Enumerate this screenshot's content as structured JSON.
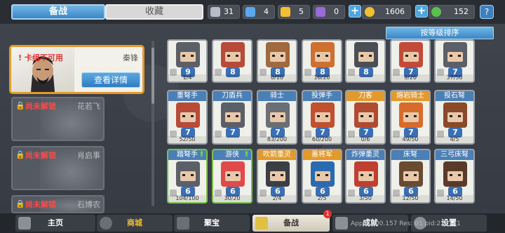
{
  "tabs": {
    "main": "备战",
    "collection": "收藏"
  },
  "resources": [
    {
      "icon": "silver-card-icon",
      "value": "31",
      "color": "#b8bcc8"
    },
    {
      "icon": "blue-card-icon",
      "value": "4",
      "color": "#5aa8f0"
    },
    {
      "icon": "gold-card-icon",
      "value": "5",
      "color": "#f0c030"
    },
    {
      "icon": "purple-card-icon",
      "value": "0",
      "color": "#9a6ad8"
    },
    {
      "icon": "coin-icon",
      "value": "1606",
      "color": "#f0c030"
    },
    {
      "icon": "gem-icon",
      "value": "152",
      "color": "#5ac050"
    }
  ],
  "help": "?",
  "sort_label": "按等级排序",
  "active_card": {
    "status": "卡组不可用",
    "name": "秦锋",
    "button": "查看详情"
  },
  "locked_cards": [
    {
      "status": "尚未解锁",
      "name": "花若飞"
    },
    {
      "status": "尚未解锁",
      "name": "肖启事"
    },
    {
      "status": "尚未解锁",
      "name": "石博农"
    }
  ],
  "units_row1": [
    {
      "name": "",
      "cost": "9",
      "count": "1/4",
      "face": "#5b5f68"
    },
    {
      "name": "",
      "cost": "8",
      "count": "",
      "face": "#b84a3a"
    },
    {
      "name": "",
      "cost": "8",
      "count": "0/10",
      "face": "#a06a40"
    },
    {
      "name": "",
      "cost": "8",
      "count": "16/20",
      "face": "#d07030"
    },
    {
      "name": "",
      "cost": "8",
      "count": "",
      "face": "#4a4e55"
    },
    {
      "name": "",
      "cost": "7",
      "count": "9/20",
      "face": "#c24a3a"
    },
    {
      "name": "",
      "cost": "7",
      "count": "37/50",
      "face": "#5b5f68"
    }
  ],
  "units_row2": [
    {
      "name": "重弩手",
      "cost": "7",
      "count": "52/50",
      "face": "#b84a3a",
      "head": "blue"
    },
    {
      "name": "刀盾兵",
      "cost": "7",
      "count": "",
      "face": "#5b5f68",
      "head": "blue"
    },
    {
      "name": "骑士",
      "cost": "7",
      "count": "83/200",
      "face": "#6a6e75",
      "head": "blue"
    },
    {
      "name": "投弹手",
      "cost": "7",
      "count": "60/200",
      "face": "#c05030",
      "head": "blue"
    },
    {
      "name": "刀客",
      "cost": "7",
      "count": "0/6",
      "face": "#b04a30",
      "head": "orange"
    },
    {
      "name": "熔岩骑士",
      "cost": "7",
      "count": "49/50",
      "face": "#d86a2a",
      "head": "orange"
    },
    {
      "name": "投石弩",
      "cost": "7",
      "count": "4/5",
      "face": "#8a4a2a",
      "head": "blue"
    }
  ],
  "units_row3": [
    {
      "name": "踏弩手",
      "cost": "6",
      "count": "104/100",
      "face": "#5b5f68",
      "head": "blue",
      "up": true
    },
    {
      "name": "游侠",
      "cost": "6",
      "count": "30/20",
      "face": "#e04a4a",
      "head": "blue",
      "up": true
    },
    {
      "name": "吹箭重灵",
      "cost": "6",
      "count": "2/4",
      "face": "#3a3e45",
      "head": "orange"
    },
    {
      "name": "墨将军",
      "cost": "6",
      "count": "2/5",
      "face": "#2a6ab0",
      "head": "orange"
    },
    {
      "name": "炸弹重灵",
      "cost": "6",
      "count": "3/50",
      "face": "#c04030",
      "head": "blue"
    },
    {
      "name": "床弩",
      "cost": "6",
      "count": "12/50",
      "face": "#6a4a30",
      "head": "blue"
    },
    {
      "name": "三弓床弩",
      "cost": "6",
      "count": "14/50",
      "face": "#5a3a28",
      "head": "blue"
    }
  ],
  "nav": [
    {
      "label": "主页",
      "icon": "home-icon"
    },
    {
      "label": "商城",
      "icon": "shop-icon"
    },
    {
      "label": "聚宝",
      "icon": "treasure-icon"
    },
    {
      "label": "备战",
      "icon": "deck-icon"
    },
    {
      "label": "成就",
      "icon": "achievement-icon"
    },
    {
      "label": "设置",
      "icon": "settings-icon"
    }
  ],
  "nav_badge": "1",
  "debug_text": "App: 1000.157 Res: 01 pid:226141"
}
